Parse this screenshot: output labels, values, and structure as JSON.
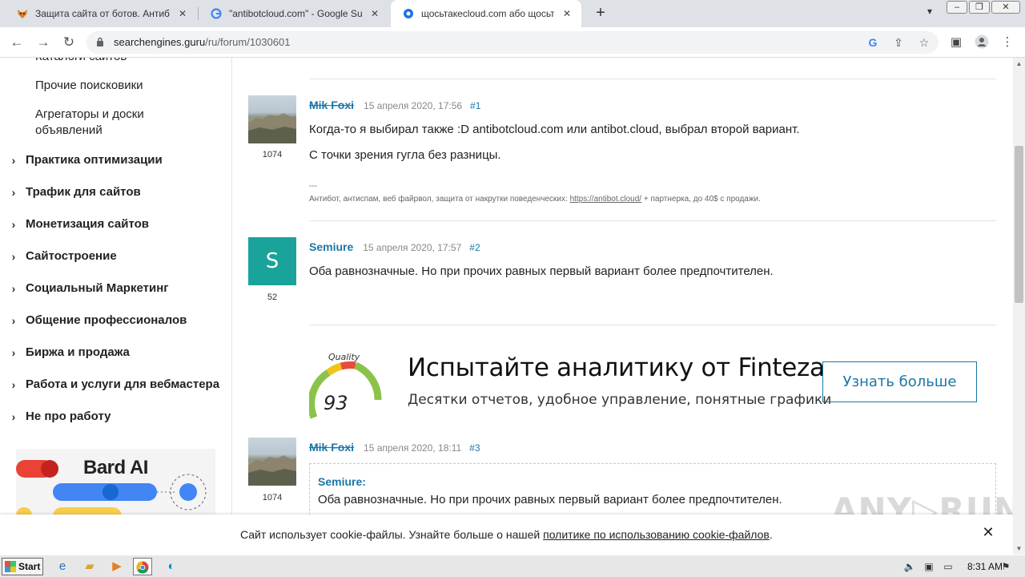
{
  "browser": {
    "tabs": [
      {
        "title": "Защита сайта от ботов. Антибот, ...",
        "favicon": "fox-icon",
        "active": false
      },
      {
        "title": "\"antibotcloud.com\" - Google Suche",
        "favicon": "google-icon",
        "active": false
      },
      {
        "title": "щосьтакеcloud.com або щосьтаке...",
        "favicon": "globe-icon",
        "active": true
      }
    ],
    "new_tab_symbol": "+",
    "url_host": "searchengines.guru",
    "url_path": "/ru/forum/1030601"
  },
  "sidebar": {
    "sub_items": [
      "Каталоги сайтов",
      "Прочие поисковики",
      "Агрегаторы и доски объявлений"
    ],
    "sections": [
      "Практика оптимизации",
      "Трафик для сайтов",
      "Монетизация сайтов",
      "Сайтостроение",
      "Социальный Маркетинг",
      "Общение профессионалов",
      "Биржа и продажа",
      "Работа и услуги для вебмастера",
      "Не про работу"
    ],
    "ad_title": "Bard AI"
  },
  "posts": [
    {
      "author": "Mik Foxi",
      "date": "15 апреля 2020, 17:56",
      "number": "#1",
      "post_count": "1074",
      "lines": [
        "Когда-то я выбирал также :D antibotcloud.com или antibot.cloud, выбрал второй вариант.",
        "С точки зрения гугла без разницы."
      ],
      "sig_dash": "---",
      "signature_prefix": "Антибот, антиспам, веб файрвол, защита от накрутки поведенческих: ",
      "signature_link": "https://antibot.cloud/",
      "signature_suffix": " + партнерка, до 40$ с продажи."
    },
    {
      "author": "Semiure",
      "date": "15 апреля 2020, 17:57",
      "number": "#2",
      "post_count": "52",
      "avatar_letter": "S",
      "lines": [
        "Оба равнозначные. Но при прочих равных первый вариант более предпочтителен."
      ]
    },
    {
      "author": "Mik Foxi",
      "date": "15 апреля 2020, 18:11",
      "number": "#3",
      "post_count": "1074",
      "quote_author": "Semiure:",
      "quote_text": "Оба равнозначные. Но при прочих равных первый вариант более предпочтителен."
    }
  ],
  "ad": {
    "gauge_label": "Quality",
    "gauge_value": "93",
    "headline": "Испытайте аналитику от Finteza",
    "subline": "Десятки отчетов, удобное управление, понятные графики",
    "button": "Узнать больше"
  },
  "cookie": {
    "text_before": "Сайт использует cookie-файлы. Узнайте больше о нашей ",
    "link": "политике по использованию cookie-файлов",
    "text_after": ".",
    "close": "✕"
  },
  "watermark": "ANY▷RUN",
  "taskbar": {
    "start_label": "Start",
    "time": "8:31 AM"
  },
  "colors": {
    "link_blue": "#1b76a8",
    "avatar_teal": "#1aa39a"
  }
}
